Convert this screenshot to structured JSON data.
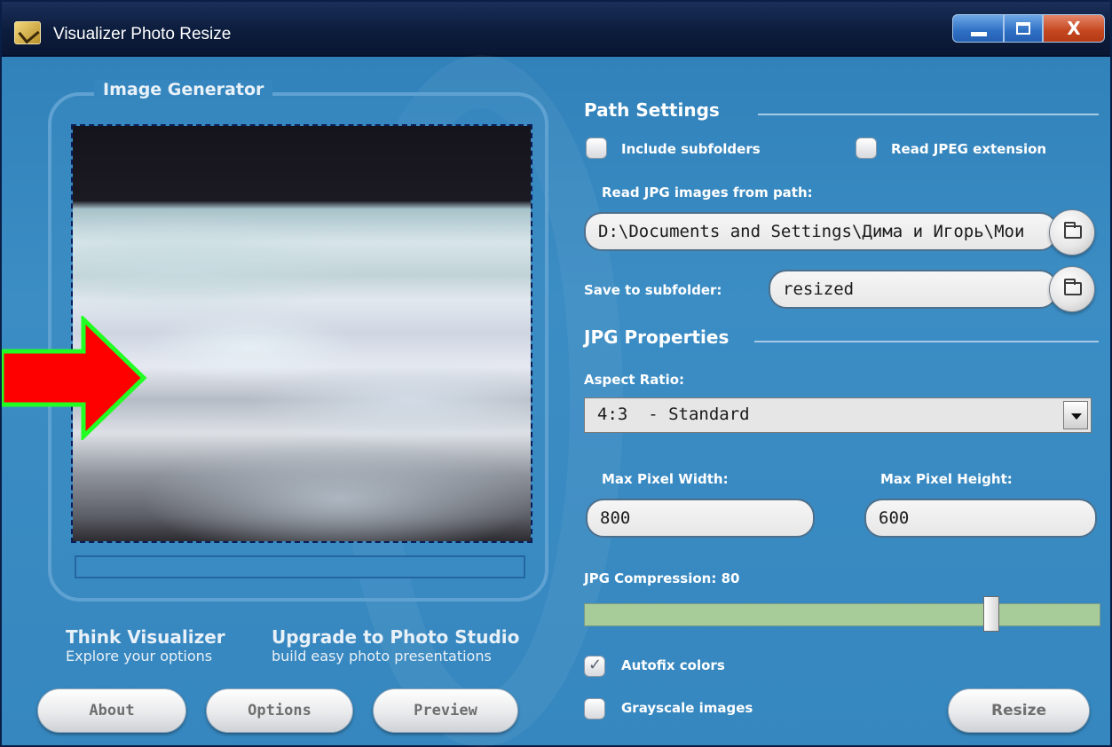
{
  "window": {
    "title": "Visualizer Photo Resize",
    "close_glyph": "X"
  },
  "image_generator": {
    "group_label": "Image Generator"
  },
  "promos": {
    "think_title": "Think Visualizer",
    "think_sub": "Explore your options",
    "upgrade_title": "Upgrade to Photo Studio",
    "upgrade_sub": "build easy photo presentations"
  },
  "buttons": {
    "about": "About",
    "options": "Options",
    "preview": "Preview",
    "resize": "Resize"
  },
  "path_settings": {
    "title": "Path Settings",
    "include_subfolders": {
      "label": "Include subfolders",
      "checked": false
    },
    "read_jpeg_extension": {
      "label": "Read JPEG extension",
      "checked": false
    },
    "read_path_label": "Read JPG images from path:",
    "read_path_value": "D:\\Documents and Settings\\Дима и Игорь\\Мои",
    "save_subfolder_label": "Save to subfolder:",
    "save_subfolder_value": "resized"
  },
  "jpg_properties": {
    "title": "JPG Properties",
    "aspect_ratio_label": "Aspect Ratio:",
    "aspect_ratio_value": "4:3  - Standard",
    "max_width_label": "Max Pixel Width:",
    "max_width_value": "800",
    "max_height_label": "Max Pixel Height:",
    "max_height_value": "600",
    "compression_label": "JPG Compression: 80",
    "compression_value": 80,
    "autofix_colors": {
      "label": "Autofix colors",
      "checked": true
    },
    "grayscale_images": {
      "label": "Grayscale images",
      "checked": false
    }
  },
  "colors": {
    "window_bg": "#3687bf",
    "titlebar": "#0c1c3c",
    "slider_track": "#a8cb9a",
    "arrow_fill": "#ff0000",
    "arrow_stroke": "#22ff22"
  }
}
